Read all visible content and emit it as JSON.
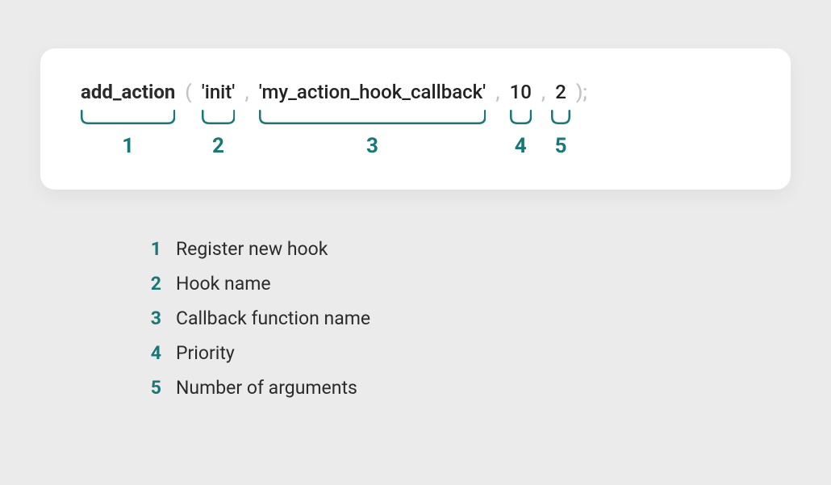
{
  "colors": {
    "teal": "#167877",
    "bg": "#ebebeb",
    "card": "#ffffff"
  },
  "code": {
    "func": "add_action",
    "open_paren": "(",
    "arg1": "'init'",
    "comma": ",",
    "arg2": "'my_action_hook_callback'",
    "arg3": "10",
    "arg4": "2",
    "close": ");"
  },
  "annotations": {
    "n1": "1",
    "n2": "2",
    "n3": "3",
    "n4": "4",
    "n5": "5"
  },
  "legend": [
    {
      "num": "1",
      "text": "Register new hook"
    },
    {
      "num": "2",
      "text": "Hook name"
    },
    {
      "num": "3",
      "text": "Callback function name"
    },
    {
      "num": "4",
      "text": "Priority"
    },
    {
      "num": "5",
      "text": "Number of arguments"
    }
  ]
}
